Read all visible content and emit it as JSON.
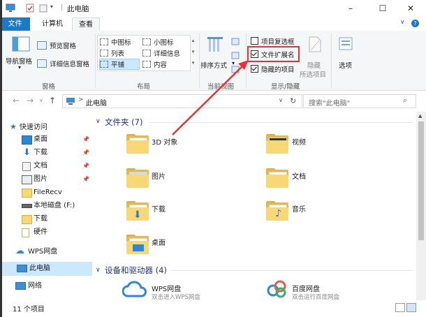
{
  "window": {
    "title": "此电脑",
    "controls": [
      "–",
      "☐",
      "✕"
    ]
  },
  "ribbon_tabs": {
    "file": "文件",
    "computer": "计算机",
    "view": "查看",
    "help_icon": "?"
  },
  "ribbon": {
    "panes": {
      "nav_pane": "导航窗格",
      "preview_pane": "预览窗格",
      "details_pane": "详细信息窗格",
      "group_label": "窗格"
    },
    "layout": {
      "items": [
        "中图标",
        "小图标",
        "列表",
        "详细信息",
        "平铺",
        "内容"
      ],
      "selected": "平铺",
      "group_label": "布局"
    },
    "current_view": {
      "sort_by": "排序方式",
      "group_label": "当前视图"
    },
    "show_hide": {
      "item_checkboxes": "项目复选框",
      "file_extensions": "文件扩展名",
      "hidden_items": "隐藏的项目",
      "hide": "隐藏",
      "hide_selected": "所选项目",
      "group_label": "显示/隐藏",
      "item_checkboxes_checked": false,
      "file_extensions_checked": true,
      "hidden_items_checked": true
    },
    "options": "选项"
  },
  "navbar": {
    "path_separator": ">",
    "path": "此电脑",
    "search_placeholder": "搜索\"此电脑\""
  },
  "nav_pane": {
    "quick_access": "快速访问",
    "items": [
      {
        "label": "桌面",
        "pinned": true
      },
      {
        "label": "下载",
        "pinned": true
      },
      {
        "label": "文档",
        "pinned": true
      },
      {
        "label": "图片",
        "pinned": true
      },
      {
        "label": "FileRecv",
        "pinned": false
      },
      {
        "label": "本地磁盘 (F:)",
        "pinned": false
      },
      {
        "label": "下载",
        "pinned": false
      },
      {
        "label": "硬件",
        "pinned": false
      }
    ],
    "wps": "WPS网盘",
    "this_pc": "此电脑",
    "network": "网络"
  },
  "content": {
    "folders_header": "文件夹 (7)",
    "folders": [
      "3D 对象",
      "视频",
      "图片",
      "文档",
      "下载",
      "音乐",
      "桌面"
    ],
    "devices_header": "设备和驱动器 (4)",
    "devices": [
      {
        "name": "WPS网盘",
        "sub": "双击进入WPS网盘"
      },
      {
        "name": "百度网盘",
        "sub": "双击运行百度网盘"
      }
    ]
  },
  "status": {
    "count": "11 个项目"
  },
  "colors": {
    "accent": "#1979ca",
    "annotation": "#e53434",
    "folder": "#f8d775",
    "section_header": "#1e3287"
  }
}
